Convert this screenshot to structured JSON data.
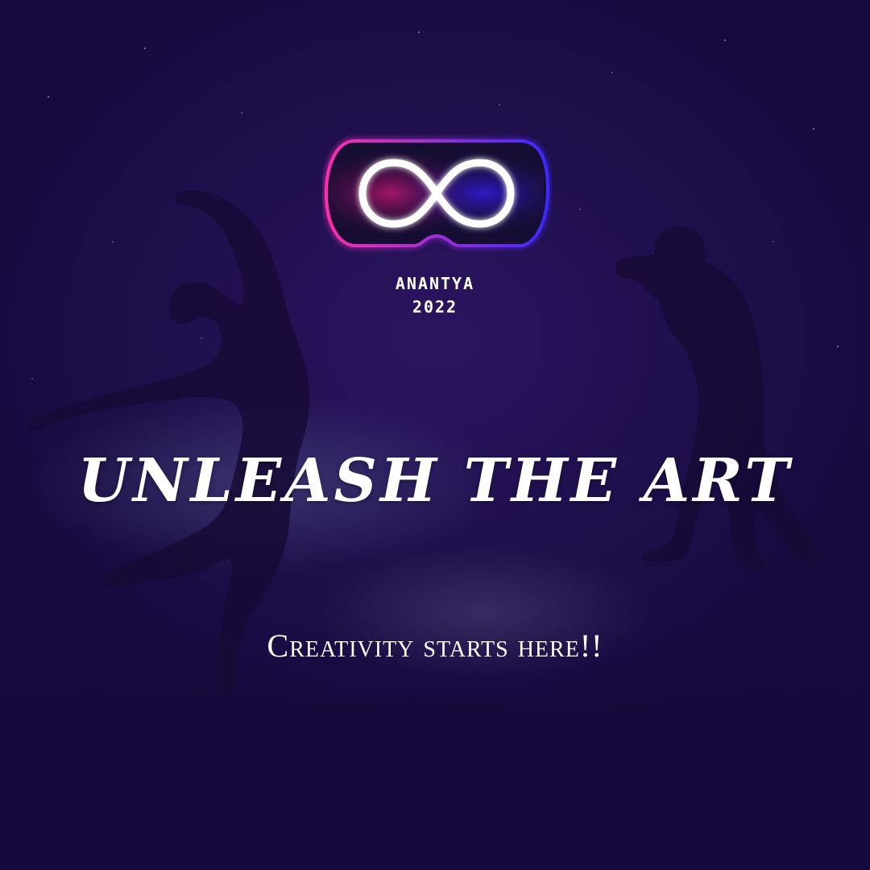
{
  "brand": {
    "name": "ANANTYA",
    "year": "2022",
    "logo_icon": "infinity-icon",
    "gradient_colors": [
      "#ff2fb0",
      "#3b2bff"
    ]
  },
  "headline": "UNLEASH THE ART",
  "tagline": "Creativity starts here!!",
  "colors": {
    "background": "#1a0d3f",
    "text": "#ffffff",
    "silhouette": "#140930"
  }
}
